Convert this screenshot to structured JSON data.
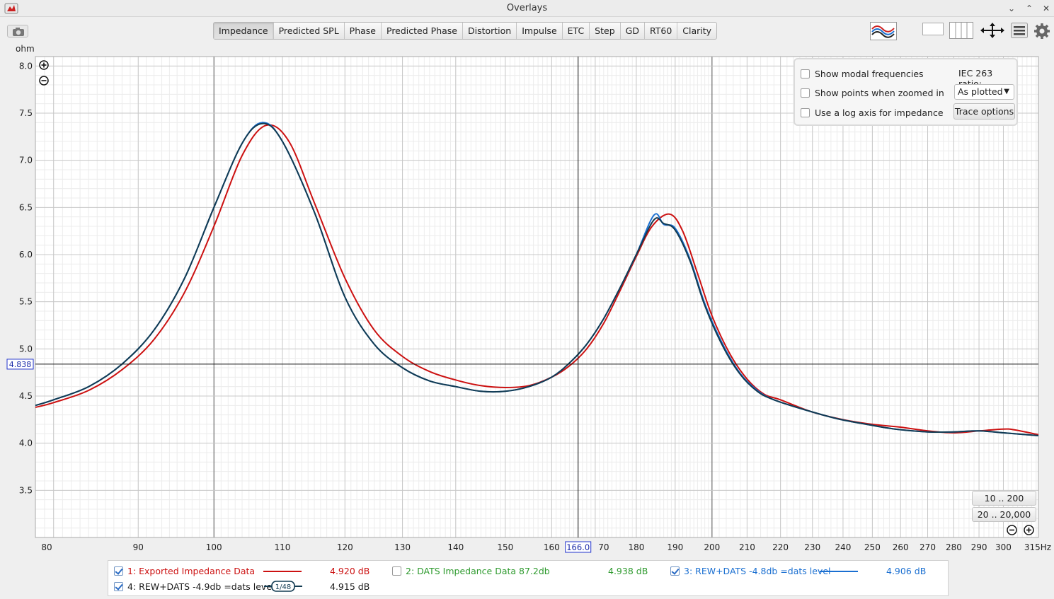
{
  "window": {
    "title": "Overlays"
  },
  "tabs": [
    "Impedance",
    "Predicted SPL",
    "Phase",
    "Predicted Phase",
    "Distortion",
    "Impulse",
    "ETC",
    "Step",
    "GD",
    "RT60",
    "Clarity"
  ],
  "active_tab": "Impedance",
  "options": {
    "show_modal": "Show modal frequencies",
    "show_points": "Show points when zoomed in",
    "log_axis": "Use a log axis for impedance",
    "iec_label": "IEC 263 ratio:",
    "plot_select": "As plotted",
    "trace_button": "Trace options"
  },
  "range_buttons": [
    "10 .. 200",
    "20 .. 20,000"
  ],
  "cursor": {
    "x_label": "166.0",
    "y_label": "4.838"
  },
  "legend": [
    {
      "label": "1: Exported Impedance Data",
      "value": "4.920 dB",
      "checked": true,
      "color": "#cc1111"
    },
    {
      "label": "2: DATS Impedance Data 87.2db",
      "value": "4.938 dB",
      "checked": false,
      "color": "#2e9a2e"
    },
    {
      "label": "3: REW+DATS  -4.8db  =dats level",
      "value": "4.906 dB",
      "checked": true,
      "color": "#1a6fd1"
    },
    {
      "label": "4: REW+DATS -4.9db  =dats level",
      "value": "4.915 dB",
      "checked": true,
      "color": "#1a1a1a",
      "smoothing": "1/48"
    }
  ],
  "chart_data": {
    "type": "line",
    "ylabel": "ohm",
    "xlabel": "",
    "x_scale": "log",
    "x_unit": "Hz",
    "xlim": [
      78,
      315
    ],
    "ylim": [
      3.0,
      8.1
    ],
    "x_ticks": [
      80,
      90,
      100,
      110,
      120,
      130,
      140,
      150,
      160,
      170,
      180,
      190,
      200,
      210,
      220,
      230,
      240,
      250,
      260,
      270,
      280,
      290,
      300,
      315
    ],
    "x_tick_labels": [
      "80",
      "90",
      "100",
      "110",
      "120",
      "130",
      "140",
      "150",
      "160",
      "",
      "180",
      "190",
      "200",
      "210",
      "220",
      "230",
      "240",
      "250",
      "260",
      "270",
      "280",
      "290",
      "300",
      "315Hz"
    ],
    "x_tick_70_label": "70",
    "y_ticks": [
      3.5,
      4.0,
      4.5,
      5.0,
      5.5,
      6.0,
      6.5,
      7.0,
      7.5,
      8.0
    ],
    "y_tick_labels": [
      "3.5",
      "4.0",
      "4.5",
      "5.0",
      "5.5",
      "6.0",
      "6.5",
      "7.0",
      "7.5",
      "8.0"
    ],
    "grid": true,
    "series": [
      {
        "name": "1: Exported Impedance Data",
        "color": "#cc1111",
        "x": [
          78,
          80,
          84,
          88,
          92,
          96,
          100,
          104,
          107.5,
          111,
          115,
          120,
          125,
          130,
          135,
          140,
          145,
          150,
          155,
          160,
          164,
          168,
          172,
          176,
          180,
          184,
          188.5,
          192,
          196,
          200,
          205,
          210,
          215,
          220,
          230,
          240,
          250,
          260,
          270,
          280,
          290,
          300,
          305,
          315
        ],
        "values": [
          4.38,
          4.43,
          4.56,
          4.78,
          5.1,
          5.6,
          6.3,
          7.05,
          7.37,
          7.2,
          6.55,
          5.75,
          5.2,
          4.92,
          4.76,
          4.67,
          4.61,
          4.59,
          4.61,
          4.7,
          4.82,
          5.0,
          5.27,
          5.62,
          5.98,
          6.3,
          6.43,
          6.25,
          5.8,
          5.35,
          4.95,
          4.68,
          4.52,
          4.46,
          4.33,
          4.25,
          4.2,
          4.17,
          4.13,
          4.11,
          4.13,
          4.15,
          4.14,
          4.09
        ]
      },
      {
        "name": "3: REW+DATS  -4.8db  =dats level",
        "color": "#1a6fd1",
        "x": [
          78,
          80,
          84,
          88,
          92,
          96,
          100,
          104,
          107,
          110,
          115,
          120,
          125,
          130,
          135,
          140,
          145,
          150,
          155,
          160,
          164,
          168,
          172,
          176,
          180,
          184.5,
          187,
          190,
          194,
          198,
          203,
          208,
          213,
          218,
          228,
          238,
          248,
          258,
          270,
          280,
          290,
          300,
          315
        ],
        "values": [
          4.4,
          4.46,
          4.6,
          4.84,
          5.2,
          5.75,
          6.5,
          7.18,
          7.4,
          7.2,
          6.45,
          5.55,
          5.05,
          4.8,
          4.66,
          4.6,
          4.55,
          4.55,
          4.6,
          4.7,
          4.85,
          5.05,
          5.32,
          5.65,
          6.0,
          6.42,
          6.32,
          6.28,
          5.95,
          5.48,
          5.05,
          4.74,
          4.56,
          4.46,
          4.35,
          4.26,
          4.2,
          4.15,
          4.12,
          4.12,
          4.13,
          4.11,
          4.08
        ]
      },
      {
        "name": "4: REW+DATS -4.9db  =dats level",
        "color": "#123b52",
        "x": [
          78,
          80,
          84,
          88,
          92,
          96,
          100,
          104,
          107,
          110,
          115,
          120,
          125,
          130,
          135,
          140,
          145,
          150,
          155,
          160,
          164,
          168,
          172,
          176,
          180,
          184.5,
          187,
          190,
          194,
          198,
          203,
          208,
          213,
          218,
          228,
          238,
          248,
          258,
          270,
          280,
          290,
          300,
          315
        ],
        "values": [
          4.4,
          4.46,
          4.6,
          4.84,
          5.2,
          5.75,
          6.5,
          7.18,
          7.39,
          7.2,
          6.45,
          5.55,
          5.05,
          4.8,
          4.66,
          4.6,
          4.55,
          4.55,
          4.6,
          4.7,
          4.85,
          5.05,
          5.32,
          5.65,
          6.0,
          6.37,
          6.33,
          6.26,
          5.93,
          5.46,
          5.03,
          4.73,
          4.55,
          4.46,
          4.35,
          4.26,
          4.2,
          4.15,
          4.12,
          4.12,
          4.13,
          4.11,
          4.08
        ]
      }
    ],
    "cursor": {
      "x": 166.0,
      "y": 4.838
    }
  }
}
